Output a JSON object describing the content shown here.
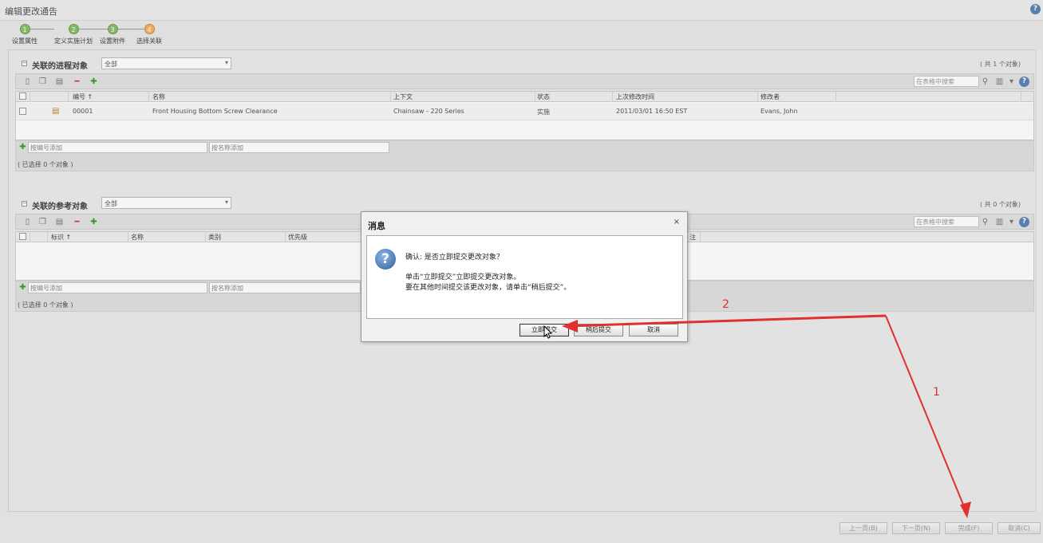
{
  "window": {
    "title": "编辑更改通告",
    "help_label": "?"
  },
  "steps": [
    {
      "num": "1",
      "label": "设置属性",
      "state": "done"
    },
    {
      "num": "2",
      "label": "定义实施计划",
      "state": "done"
    },
    {
      "num": "3",
      "label": "设置附件",
      "state": "done"
    },
    {
      "num": "4",
      "label": "选择关联",
      "state": "current"
    }
  ],
  "section1": {
    "title": "关联的进程对象",
    "filter_value": "全部",
    "count": "( 共 1 个对象)",
    "search_placeholder": "在表格中搜索",
    "columns": [
      "编号 ↑",
      "名称",
      "上下文",
      "状态",
      "上次修改时间",
      "修改者"
    ],
    "rows": [
      {
        "number": "00001",
        "name": "Front Housing Bottom Screw Clearance",
        "context": "Chainsaw - 220 Series",
        "status": "实施",
        "modified": "2011/03/01 16:50 EST",
        "modifier": "Evans, John"
      }
    ],
    "add_by_number_placeholder": "按编号添加",
    "add_by_name_placeholder": "按名称添加",
    "selected_count": "( 已选择 0 个对象 )"
  },
  "section2": {
    "title": "关联的参考对象",
    "filter_value": "全部",
    "count": "( 共 0 个对象)",
    "search_placeholder": "在表格中搜索",
    "columns": [
      "标识 ↑",
      "名称",
      "类别",
      "优先级"
    ],
    "partial_column": "注",
    "add_by_number_placeholder": "按编号添加",
    "add_by_name_placeholder": "按名称添加",
    "selected_count": "( 已选择 0 个对象 )"
  },
  "dialog": {
    "title": "消息",
    "close_label": "×",
    "icon_label": "?",
    "message_line1": "确认: 是否立即提交更改对象？",
    "message_line2": "单击“立即提交”立即提交更改对象。",
    "message_line3": "要在其他时间提交该更改对象，请单击“稍后提交”。",
    "btn_submit_now": "立即提交",
    "btn_submit_later": "稍后提交",
    "btn_cancel": "取消"
  },
  "footer": {
    "prev": "上一页(B)",
    "next": "下一页(N)",
    "finish": "完成(F)",
    "cancel": "取消(C)"
  },
  "annotations": {
    "label1": "1",
    "label2": "2"
  },
  "colors": {
    "arrow": "#e03030",
    "step_done": "#8dbf6e",
    "step_current": "#f2b36a"
  }
}
